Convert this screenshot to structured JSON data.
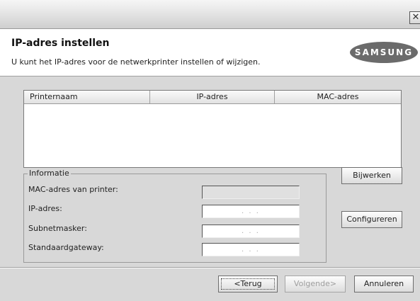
{
  "window": {
    "close_glyph": "✕"
  },
  "header": {
    "title": "IP-adres instellen",
    "subtitle": "U kunt het IP-adres voor de netwerkprinter instellen of wijzigen.",
    "logo_text": "SAMSUNG"
  },
  "printer_list": {
    "columns": [
      "Printernaam",
      "IP-adres",
      "MAC-adres"
    ],
    "rows": []
  },
  "info": {
    "group_title": "Informatie",
    "mac_label": "MAC-adres van printer:",
    "mac_value": "",
    "ip_label": "IP-adres:",
    "ip_value": ". . .",
    "subnet_label": "Subnetmasker:",
    "subnet_value": ". . .",
    "gateway_label": "Standaardgateway:",
    "gateway_value": ". . ."
  },
  "buttons": {
    "refresh": "Bijwerken",
    "configure": "Configureren",
    "back": "<Terug",
    "next": "Volgende>",
    "cancel": "Annuleren"
  },
  "colors": {
    "dialog_bg": "#d8d8d8",
    "header_bg": "#ffffff",
    "logo_bg": "#6b6b6b"
  }
}
